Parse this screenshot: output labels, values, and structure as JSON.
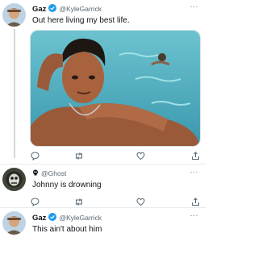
{
  "tweets": [
    {
      "name": "Gaz",
      "handle": "@KyleGarrick",
      "text": "Out here living my best life.",
      "verified": true
    },
    {
      "name": "",
      "handle": "@Ghost",
      "text": "Johnny is drowning",
      "verified": false
    },
    {
      "name": "Gaz",
      "handle": "@KyleGarrick",
      "text": "This ain't about him",
      "verified": true
    }
  ],
  "more_label": "···",
  "colors": {
    "verified": "#1d9bf0",
    "icon": "#536471",
    "water": "#4fb6c7"
  },
  "icons": [
    "comment-icon",
    "retweet-icon",
    "like-icon",
    "share-icon"
  ]
}
